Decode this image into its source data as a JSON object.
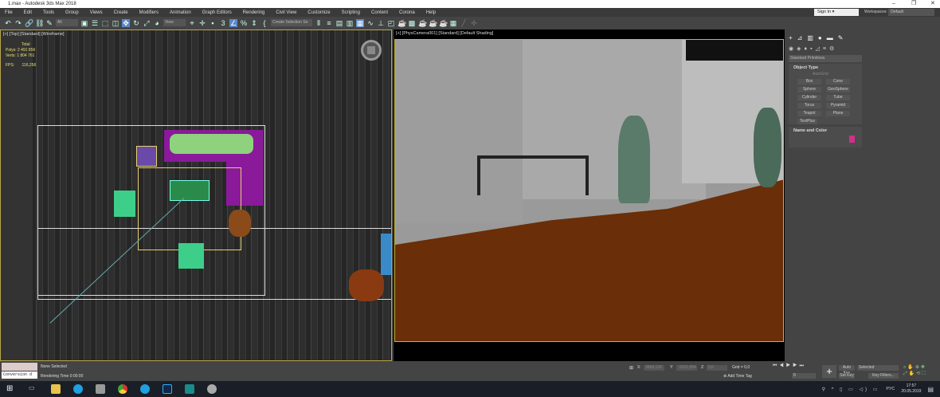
{
  "title": "1.max - Autodesk 3ds Max 2018",
  "window_controls": [
    "–",
    "❐",
    "✕"
  ],
  "menu": [
    "File",
    "Edit",
    "Tools",
    "Group",
    "Views",
    "Create",
    "Modifiers",
    "Animation",
    "Graph Editors",
    "Rendering",
    "Civil View",
    "Customize",
    "Scripting",
    "Content",
    "Corona",
    "Help"
  ],
  "signin": "Sign In",
  "workspace": {
    "label": "Workspaces:",
    "value": "Default"
  },
  "toolbar": {
    "filter": "All",
    "ref_coord": "View",
    "selection_set": "Create Selection Se"
  },
  "viewport_left": {
    "label": "[+] [Top] [Standard] [Wireframe]",
    "stats": {
      "total": "Total",
      "polys_label": "Polys:",
      "polys": "2 491 856",
      "verts_label": "Verts:",
      "verts": "1 804 761",
      "fps_label": "FPS:",
      "fps": "116,256"
    }
  },
  "viewport_right": {
    "label": "[+] [PhysCamera001] [Standard] [Default Shading]"
  },
  "command_panel": {
    "category": "Standard Primitives",
    "object_type": "Object Type",
    "autogrid": "AutoGrid",
    "buttons": [
      "Box",
      "Cone",
      "Sphere",
      "GeoSphere",
      "Cylinder",
      "Tube",
      "Torus",
      "Pyramid",
      "Teapot",
      "Plane",
      "TextPlus"
    ],
    "name_color": "Name and Color",
    "color": "#d0308a"
  },
  "status": {
    "script_field": "Conversion d",
    "selection": "None Selected",
    "render_time": "Rendering Time  0:00:00",
    "x_label": "X:",
    "x": "3868,126",
    "y_label": "Y:",
    "y": "-1031,954",
    "z_label": "Z:",
    "z": "0,0",
    "grid": "Grid = 0,0",
    "add_time_tag": "Add Time Tag",
    "frame": "0",
    "auto_key": "Auto Key",
    "set_key": "Set Key",
    "key_mode": "Selected",
    "key_filters": "Key Filters..."
  },
  "taskbar": {
    "lang": "РУС",
    "time": "17:57",
    "date": "20.05.2019"
  }
}
